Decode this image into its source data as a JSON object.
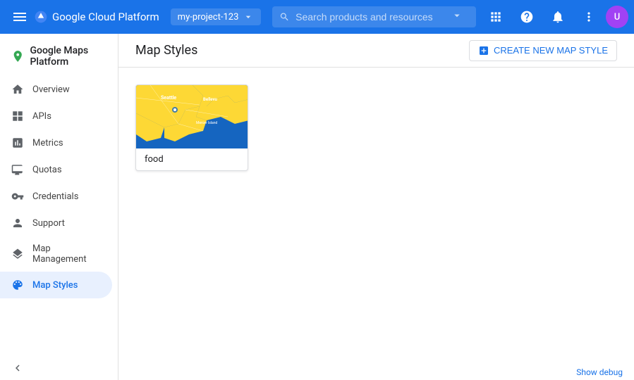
{
  "topbar": {
    "title": "Google Cloud Platform",
    "project_name": "my-project-123",
    "search_placeholder": "Search products and resources"
  },
  "sidebar": {
    "brand": "Google Maps Platform",
    "nav_items": [
      {
        "id": "overview",
        "label": "Overview",
        "icon": "home"
      },
      {
        "id": "apis",
        "label": "APIs",
        "icon": "grid"
      },
      {
        "id": "metrics",
        "label": "Metrics",
        "icon": "chart"
      },
      {
        "id": "quotas",
        "label": "Quotas",
        "icon": "monitor"
      },
      {
        "id": "credentials",
        "label": "Credentials",
        "icon": "key"
      },
      {
        "id": "support",
        "label": "Support",
        "icon": "person"
      },
      {
        "id": "map-management",
        "label": "Map Management",
        "icon": "layers"
      },
      {
        "id": "map-styles",
        "label": "Map Styles",
        "icon": "palette",
        "active": true
      }
    ]
  },
  "content": {
    "header": {
      "title": "Map Styles",
      "create_button": "CREATE NEW MAP STYLE"
    },
    "map_cards": [
      {
        "id": "food-map",
        "label": "food"
      }
    ]
  },
  "footer": {
    "debug_label": "Show debug"
  }
}
